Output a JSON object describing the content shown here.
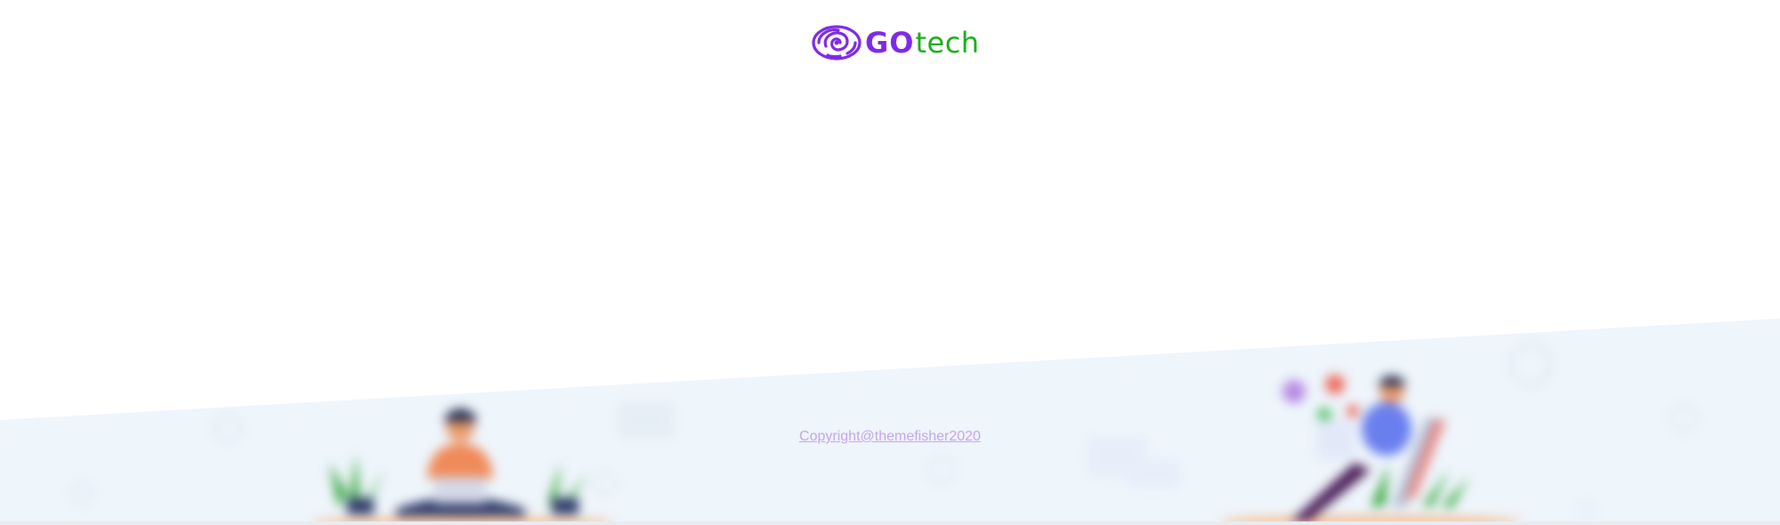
{
  "header": {
    "logo": {
      "icon": "fingerprint-spiral-icon",
      "text_primary": "GO",
      "text_secondary": "tech",
      "primary_color": "#7d2ae8",
      "secondary_color": "#1aad19"
    }
  },
  "footer": {
    "copyright_text": "Copyright@themefisher2020",
    "link_color": "#c6a4e8",
    "background_color": "#eef5fb",
    "illustrations": [
      "person-with-laptop-illustration",
      "person-on-chair-illustration"
    ]
  }
}
